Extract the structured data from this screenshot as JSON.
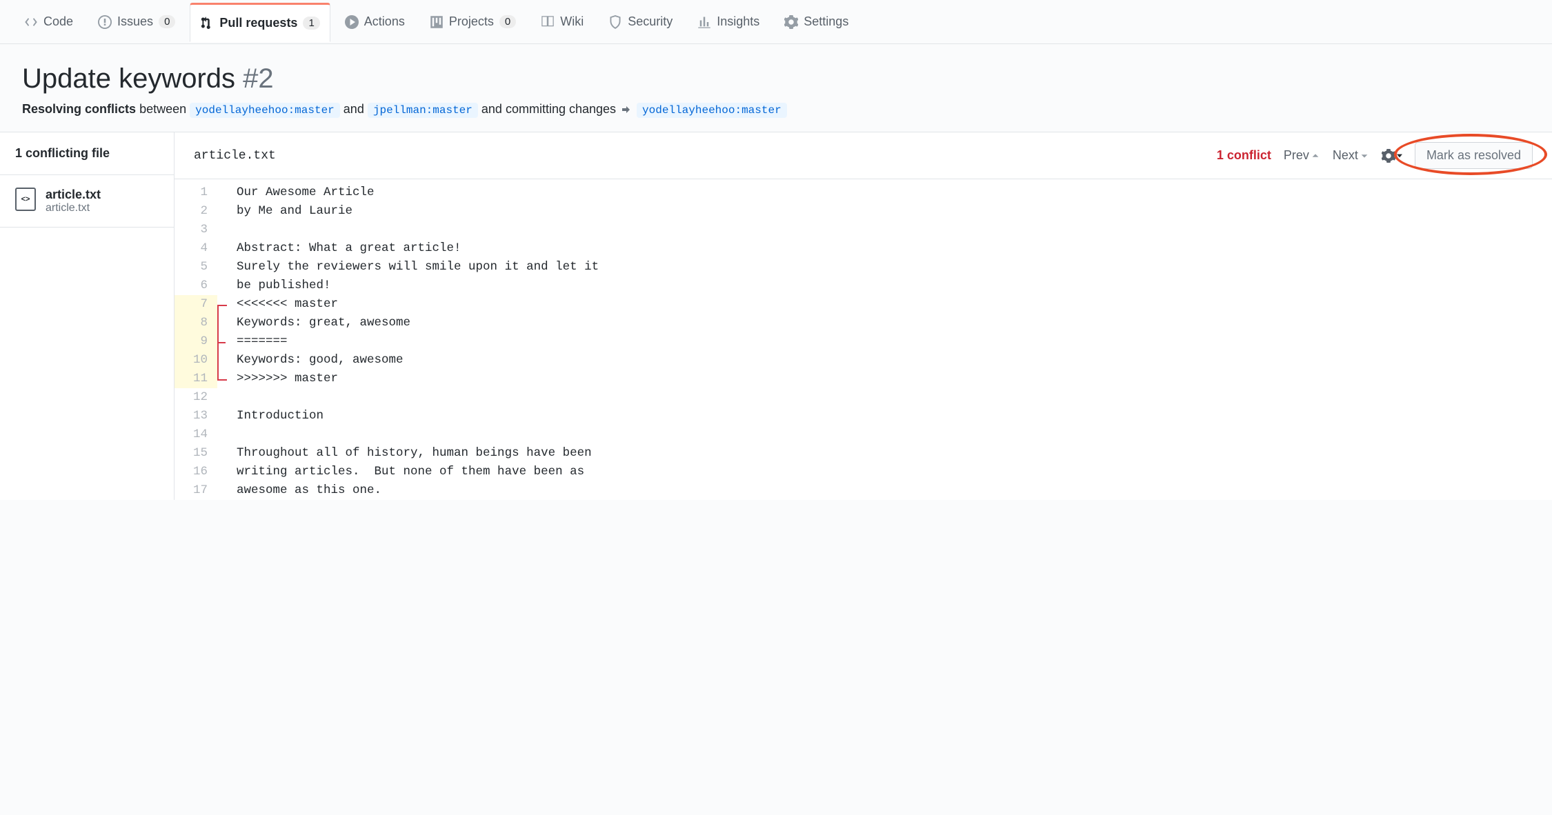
{
  "tabs": {
    "code": "Code",
    "issues": "Issues",
    "issues_count": "0",
    "pulls": "Pull requests",
    "pulls_count": "1",
    "actions": "Actions",
    "projects": "Projects",
    "projects_count": "0",
    "wiki": "Wiki",
    "security": "Security",
    "insights": "Insights",
    "settings": "Settings"
  },
  "pr": {
    "title": "Update keywords",
    "number": "#2",
    "resolving_label": "Resolving conflicts",
    "between_label": "between",
    "base_branch": "yodellayheehoo:master",
    "and_label": "and",
    "head_branch": "jpellman:master",
    "committing_label": "and committing changes",
    "target_branch": "yodellayheehoo:master"
  },
  "sidebar": {
    "header": "1 conflicting file",
    "file": {
      "name": "article.txt",
      "path": "article.txt"
    }
  },
  "editor": {
    "filename": "article.txt",
    "conflict_count": "1 conflict",
    "prev": "Prev",
    "next": "Next",
    "mark_resolved": "Mark as resolved"
  },
  "code": {
    "lines": [
      {
        "n": "1",
        "t": "Our Awesome Article",
        "c": false
      },
      {
        "n": "2",
        "t": "by Me and Laurie",
        "c": false
      },
      {
        "n": "3",
        "t": "",
        "c": false
      },
      {
        "n": "4",
        "t": "Abstract: What a great article!",
        "c": false
      },
      {
        "n": "5",
        "t": "Surely the reviewers will smile upon it and let it",
        "c": false
      },
      {
        "n": "6",
        "t": "be published!",
        "c": false
      },
      {
        "n": "7",
        "t": "<<<<<<< master",
        "c": true
      },
      {
        "n": "8",
        "t": "Keywords: great, awesome",
        "c": true
      },
      {
        "n": "9",
        "t": "=======",
        "c": true,
        "cursor": true
      },
      {
        "n": "10",
        "t": "Keywords: good, awesome",
        "c": true
      },
      {
        "n": "11",
        "t": ">>>>>>> master",
        "c": true
      },
      {
        "n": "12",
        "t": "",
        "c": false
      },
      {
        "n": "13",
        "t": "Introduction",
        "c": false
      },
      {
        "n": "14",
        "t": "",
        "c": false
      },
      {
        "n": "15",
        "t": "Throughout all of history, human beings have been",
        "c": false
      },
      {
        "n": "16",
        "t": "writing articles.  But none of them have been as",
        "c": false
      },
      {
        "n": "17",
        "t": "awesome as this one.",
        "c": false
      }
    ]
  }
}
